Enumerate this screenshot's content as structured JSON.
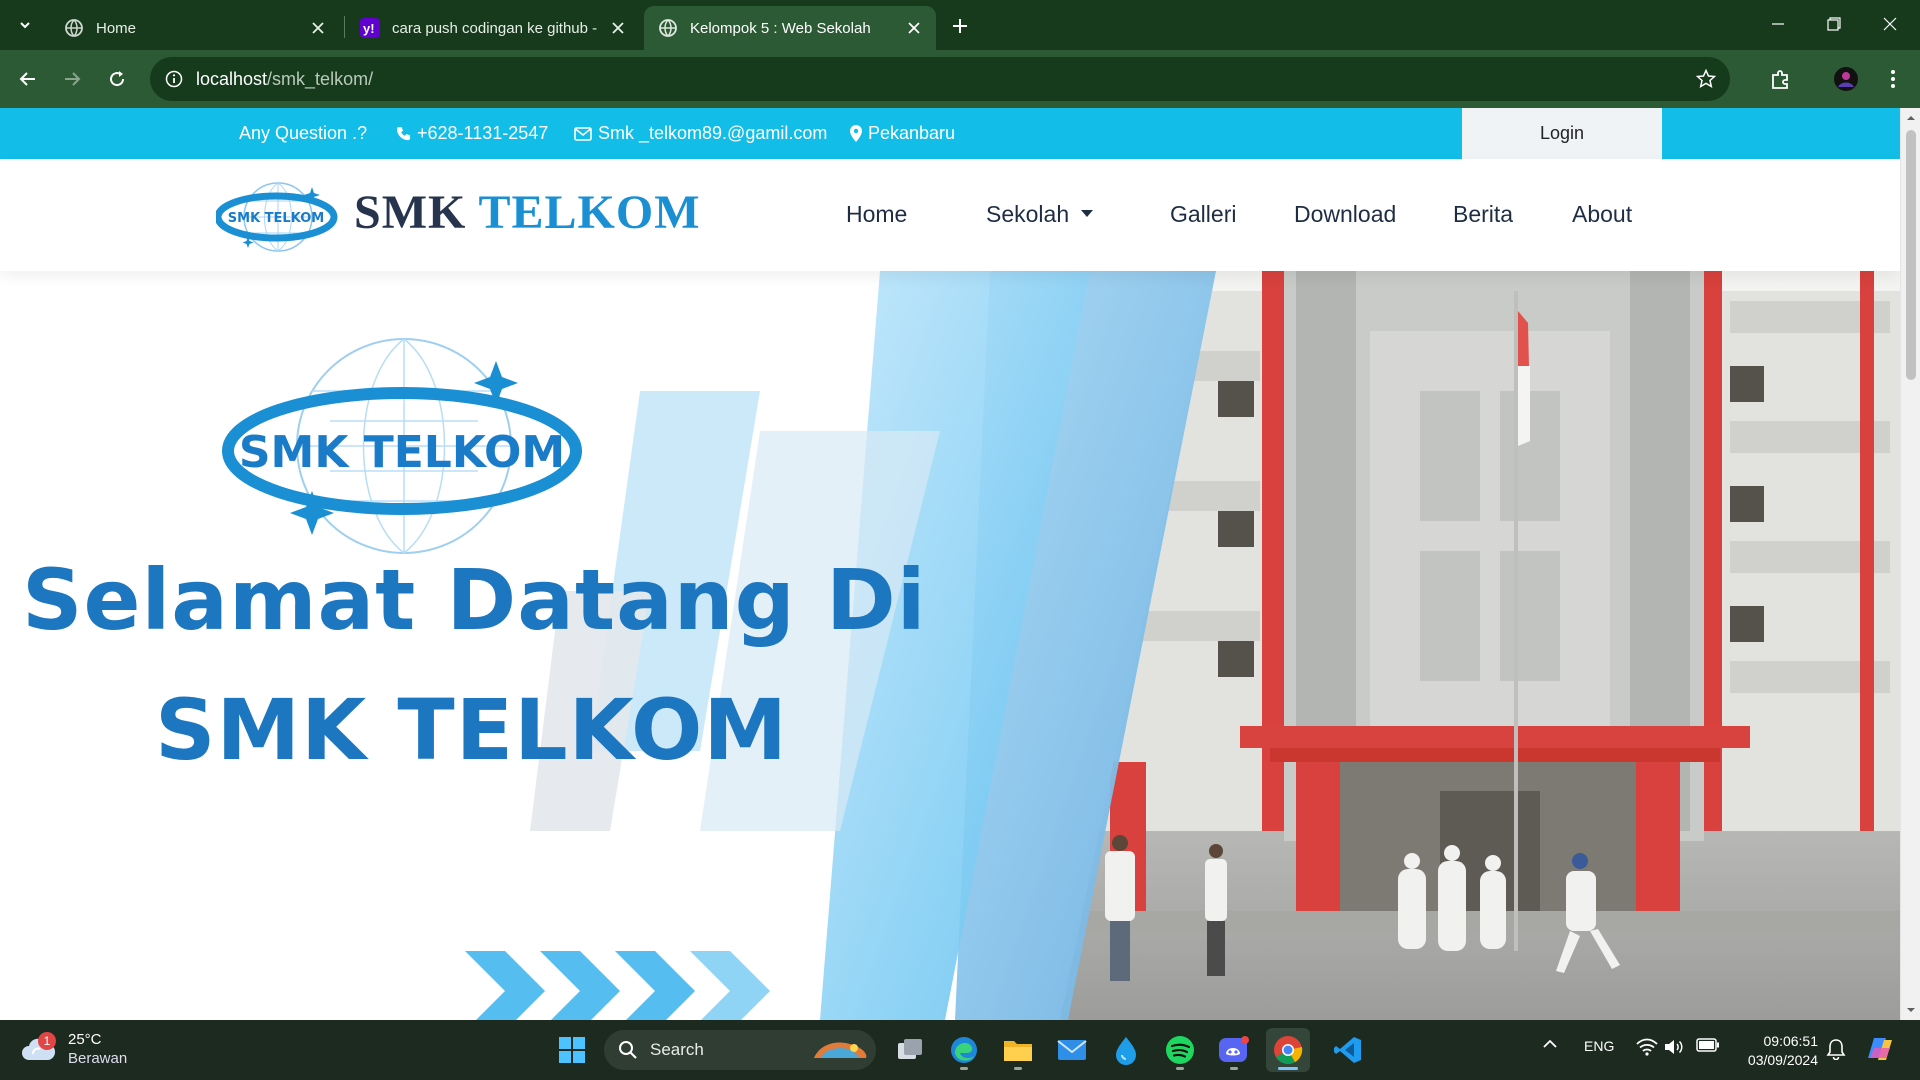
{
  "browser": {
    "tabs": [
      {
        "title": "Home",
        "icon": "globe-icon",
        "active": false
      },
      {
        "title": "cara push codingan ke github -",
        "icon": "yahoo-icon",
        "active": false
      },
      {
        "title": "Kelompok 5 : Web Sekolah",
        "icon": "globe-icon",
        "active": true
      }
    ],
    "address": {
      "host": "localhost",
      "path": "/smk_telkom/"
    }
  },
  "site": {
    "topbar": {
      "question": "Any Question .?",
      "phone": "+628-1131-2547",
      "email": "Smk _telkom89.@gamil.com",
      "location": "Pekanbaru",
      "login": "Login"
    },
    "brand": {
      "part1": "SMK",
      "part2": "TELKOM",
      "logo_text": "SMK TELKOM"
    },
    "menu": [
      "Home",
      "Sekolah",
      "Galleri",
      "Download",
      "Berita",
      "About"
    ],
    "hero": {
      "logo_text": "SMK TELKOM",
      "line1": "Selamat Datang Di",
      "line2": "SMK TELKOM"
    }
  },
  "taskbar": {
    "weather": {
      "temp": "25°C",
      "desc": "Berawan",
      "badge": "1"
    },
    "search_label": "Search",
    "lang": "ENG",
    "time": "09:06:51",
    "date": "03/09/2024"
  },
  "colors": {
    "topbar": "#12bde8",
    "brand_dark": "#27344e",
    "brand_blue": "#1a8fd4",
    "hero_text": "#1d77c0",
    "chrome_dark": "#173a1d",
    "chrome_toolbar": "#2c5a34"
  }
}
